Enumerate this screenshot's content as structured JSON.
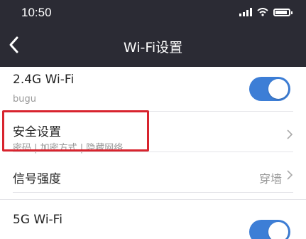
{
  "status_bar": {
    "time": "10:50"
  },
  "header": {
    "title": "Wi-Fi设置"
  },
  "rows": [
    {
      "label": "2.4G Wi-Fi",
      "sub": "bugu",
      "toggle_on": true
    },
    {
      "label": "安全设置",
      "sub": "密码 | 加密方式 | 隐藏网络"
    },
    {
      "label": "信号强度",
      "value": "穿墙"
    },
    {
      "label": "5G Wi-Fi",
      "toggle_on": true
    }
  ],
  "colors": {
    "header_bg": "#2b2b34",
    "toggle_on": "#3d7ed6",
    "highlight": "#d8242e"
  },
  "icons": [
    "back-arrow-icon",
    "signal-icon",
    "wifi-icon",
    "battery-icon",
    "chevron-right-icon"
  ]
}
